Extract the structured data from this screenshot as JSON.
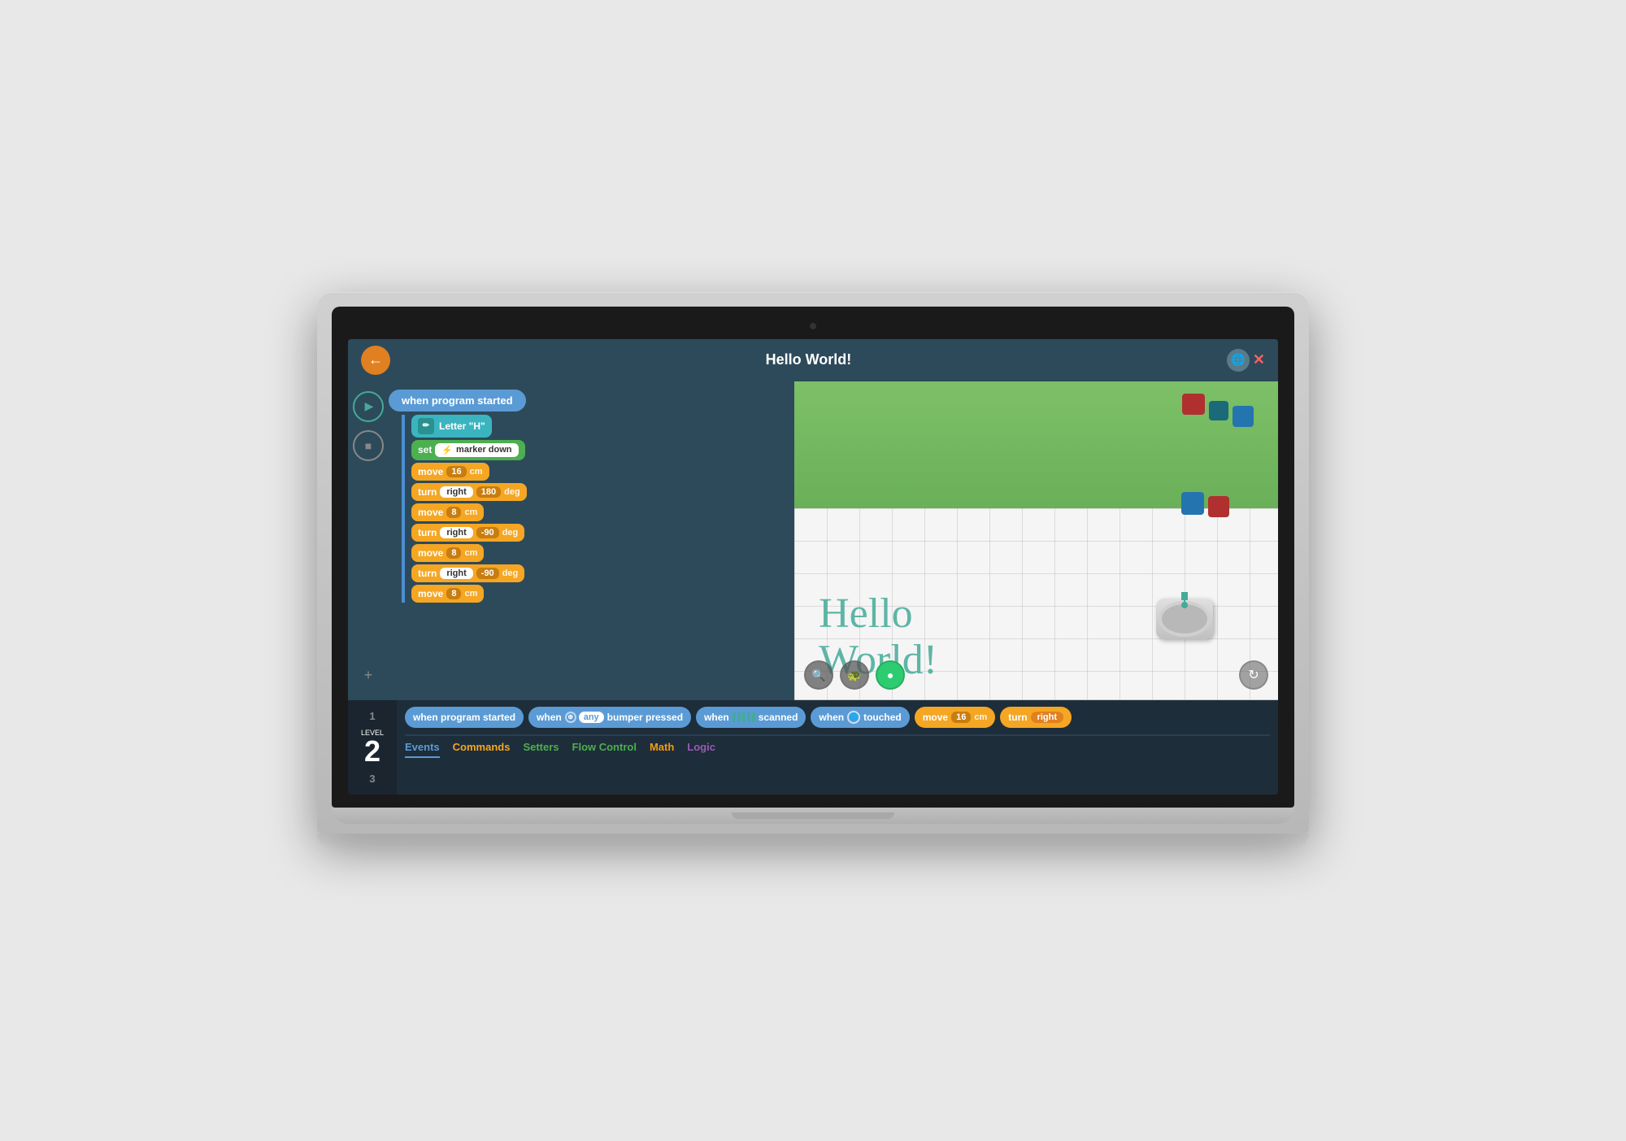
{
  "header": {
    "title": "Hello World!",
    "back_label": "←",
    "close_label": "✕"
  },
  "code_blocks": {
    "trigger": "when program started",
    "blocks": [
      {
        "type": "letter",
        "label": "Letter \"H\""
      },
      {
        "type": "set",
        "label": "set",
        "value": "marker down"
      },
      {
        "type": "move",
        "label": "move",
        "num": "16",
        "unit": "cm"
      },
      {
        "type": "turn",
        "label": "turn",
        "dir": "right",
        "num": "180",
        "unit": "deg"
      },
      {
        "type": "move",
        "label": "move",
        "num": "8",
        "unit": "cm"
      },
      {
        "type": "turn",
        "label": "turn",
        "dir": "right",
        "num": "-90",
        "unit": "deg"
      },
      {
        "type": "move",
        "label": "move",
        "num": "8",
        "unit": "cm"
      },
      {
        "type": "turn",
        "label": "turn",
        "dir": "right",
        "num": "-90",
        "unit": "deg"
      },
      {
        "type": "move",
        "label": "move",
        "num": "8",
        "unit": "cm"
      }
    ]
  },
  "sim": {
    "hello_world_text": "Hello\nWorld!",
    "refresh_icon": "↻",
    "zoom_icon": "🔍",
    "speed_icon": "🐢",
    "run_icon": "●"
  },
  "level": {
    "label": "LEVEL",
    "current": "2",
    "items": [
      "1",
      "2",
      "3"
    ]
  },
  "palette": {
    "blocks": [
      {
        "label": "when program started",
        "type": "blue"
      },
      {
        "label": "any bumper pressed",
        "type": "blue",
        "prefix": "when",
        "has_any": true
      },
      {
        "label": "scanned",
        "type": "blue",
        "prefix": "when",
        "has_scan": true
      },
      {
        "label": "touched",
        "type": "blue",
        "prefix": "when",
        "has_globe": true
      },
      {
        "label": "move 16 cm",
        "type": "yellow"
      },
      {
        "label": "turn right",
        "type": "yellow",
        "has_right": true
      }
    ]
  },
  "categories": [
    {
      "label": "Events",
      "class": "events",
      "active": true
    },
    {
      "label": "Commands",
      "class": "commands"
    },
    {
      "label": "Setters",
      "class": "setters"
    },
    {
      "label": "Flow Control",
      "class": "flow"
    },
    {
      "label": "Math",
      "class": "math"
    },
    {
      "label": "Logic",
      "class": "logic"
    }
  ]
}
